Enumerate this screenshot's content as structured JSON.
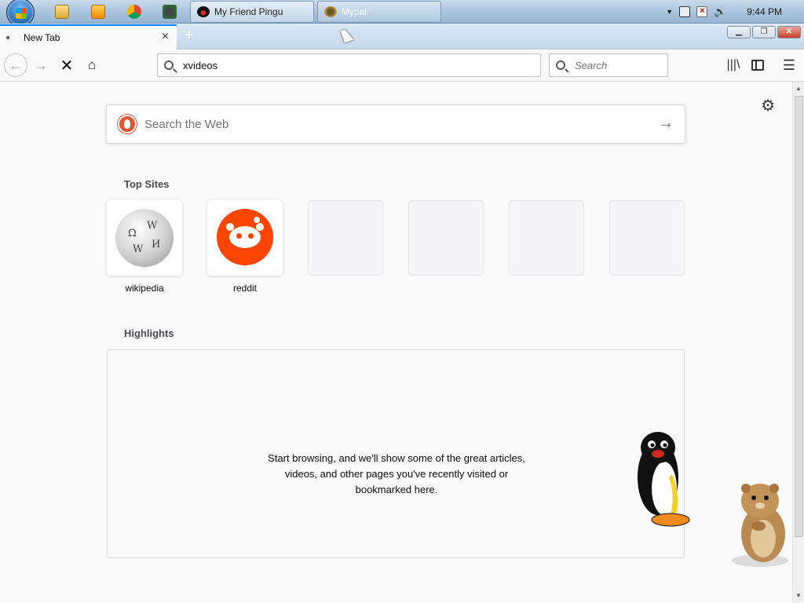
{
  "taskbar": {
    "tasks": [
      {
        "label": "My Friend Pingu"
      },
      {
        "label": "Mypal"
      }
    ],
    "clock": "9:44 PM"
  },
  "browser": {
    "tab": {
      "title": "New Tab"
    },
    "url": "xvideos",
    "search_placeholder": "Search"
  },
  "newtab": {
    "search_placeholder": "Search the Web",
    "top_sites_title": "Top Sites",
    "top_sites": [
      {
        "label": "wikipedia"
      },
      {
        "label": "reddit"
      }
    ],
    "highlights_title": "Highlights",
    "highlights_message": "Start browsing, and we'll show some of the great articles, videos, and other pages you've recently visited or bookmarked here."
  },
  "colors": {
    "accent": "#0a84ff",
    "reddit": "#ff4500",
    "duckduckgo": "#de5833"
  }
}
